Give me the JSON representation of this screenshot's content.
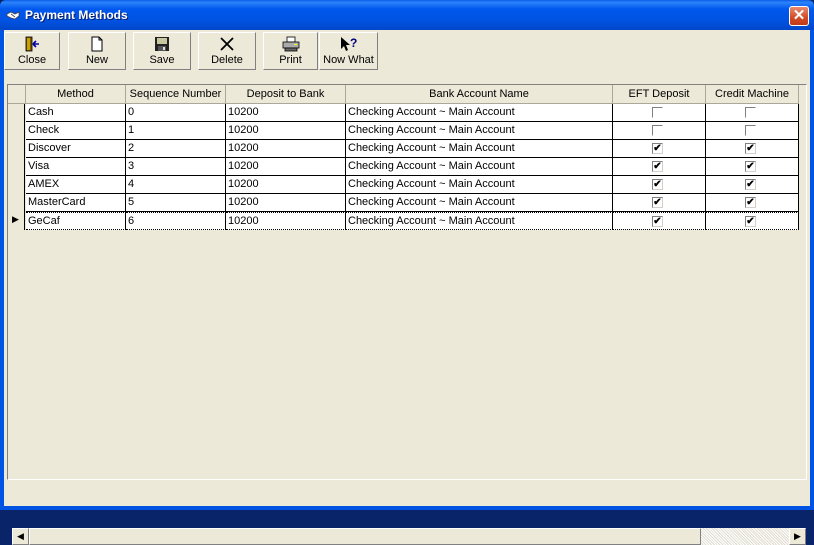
{
  "window": {
    "title": "Payment Methods",
    "title_icon": "handshake-icon",
    "close_glyph": "✕"
  },
  "toolbar": {
    "buttons": [
      {
        "label": "Close",
        "icon": "exit-door-icon"
      },
      {
        "label": "New",
        "icon": "new-document-icon"
      },
      {
        "label": "Save",
        "icon": "floppy-disk-icon"
      },
      {
        "label": "Delete",
        "icon": "delete-x-icon"
      },
      {
        "label": "Print",
        "icon": "printer-icon"
      },
      {
        "label": "Now What",
        "icon": "help-pointer-icon"
      }
    ]
  },
  "grid": {
    "columns": [
      "Method",
      "Sequence Number",
      "Deposit to Bank",
      "Bank Account Name",
      "EFT Deposit",
      "Credit Machine"
    ],
    "rows": [
      {
        "method": "Cash",
        "sequence": "0",
        "deposit_bank": "10200",
        "account_name": "Checking Account ~ Main Account",
        "eft": false,
        "credit_machine": false
      },
      {
        "method": "Check",
        "sequence": "1",
        "deposit_bank": "10200",
        "account_name": "Checking Account ~ Main Account",
        "eft": false,
        "credit_machine": false
      },
      {
        "method": "Discover",
        "sequence": "2",
        "deposit_bank": "10200",
        "account_name": "Checking Account ~ Main Account",
        "eft": true,
        "credit_machine": true
      },
      {
        "method": "Visa",
        "sequence": "3",
        "deposit_bank": "10200",
        "account_name": "Checking Account ~ Main Account",
        "eft": true,
        "credit_machine": true
      },
      {
        "method": "AMEX",
        "sequence": "4",
        "deposit_bank": "10200",
        "account_name": "Checking Account ~ Main Account",
        "eft": true,
        "credit_machine": true
      },
      {
        "method": "MasterCard",
        "sequence": "5",
        "deposit_bank": "10200",
        "account_name": "Checking Account ~ Main Account",
        "eft": true,
        "credit_machine": true
      },
      {
        "method": "GeCaf",
        "sequence": "6",
        "deposit_bank": "10200",
        "account_name": "Checking Account ~ Main Account",
        "eft": true,
        "credit_machine": true
      }
    ],
    "current_row_index": 6,
    "current_row_marker": "▶",
    "check_glyph": "✔"
  },
  "scrollbar": {
    "left_arrow": "◀",
    "right_arrow": "▶"
  }
}
